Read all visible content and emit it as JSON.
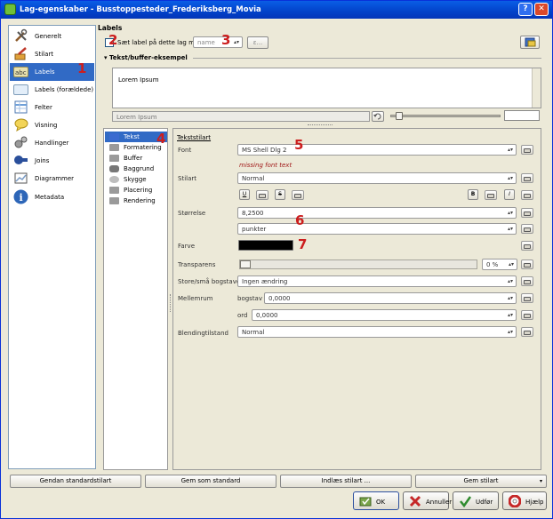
{
  "window": {
    "title": "Lag-egenskaber - Busstoppesteder_Frederiksberg_Movia",
    "help_btn": "?",
    "close_btn": "✕"
  },
  "sidebar": {
    "items": [
      {
        "label": "Generelt",
        "icon": "tools-icon",
        "color": "#8b5a2b"
      },
      {
        "label": "Stilart",
        "icon": "brush-icon",
        "color": "#c0392b"
      },
      {
        "label": "Labels",
        "icon": "abc-label-icon",
        "color": "#e8e1b0",
        "active": true
      },
      {
        "label": "Labels (forældede)",
        "icon": "labels-old-icon",
        "color": "#e3eef9"
      },
      {
        "label": "Felter",
        "icon": "table-icon",
        "color": "#6e9fd8"
      },
      {
        "label": "Visning",
        "icon": "speech-bubble-icon",
        "color": "#f2d458"
      },
      {
        "label": "Handlinger",
        "icon": "gears-icon",
        "color": "#808080"
      },
      {
        "label": "Joins",
        "icon": "joins-icon",
        "color": "#2a4f9b"
      },
      {
        "label": "Diagrammer",
        "icon": "diagram-icon",
        "color": "#7a9cc6"
      },
      {
        "label": "Metadata",
        "icon": "info-icon",
        "color": "#2d66b8"
      }
    ]
  },
  "labels": {
    "title": "Labels",
    "checkbox_label": "Sæt label på dette lag med",
    "field_combo": "name",
    "expression_btn": "ε...",
    "section_title": "Tekst/buffer-eksempel",
    "preview_text": "Lorem Ipsum",
    "preview_input": "Lorem Ipsum"
  },
  "tabs": [
    {
      "label": "Tekst",
      "icon": "text-tab-icon",
      "color": "#3a6ad0",
      "active": true
    },
    {
      "label": "Formatering",
      "icon": "formatting-tab-icon",
      "color": "#9a9a9a"
    },
    {
      "label": "Buffer",
      "icon": "buffer-tab-icon",
      "color": "#9a9a9a"
    },
    {
      "label": "Baggrund",
      "icon": "background-tab-icon",
      "color": "#777777"
    },
    {
      "label": "Skygge",
      "icon": "shadow-tab-icon",
      "color": "#bdbdbd"
    },
    {
      "label": "Placering",
      "icon": "placement-tab-icon",
      "color": "#9a9a9a"
    },
    {
      "label": "Rendering",
      "icon": "rendering-tab-icon",
      "color": "#9a9a9a"
    }
  ],
  "text_style": {
    "subtitle": "Tekststilart",
    "font_label": "Font",
    "font_value": "MS Shell Dlg 2",
    "missing_font": "missing font text",
    "style_label": "Stilart",
    "style_value": "Normal",
    "underline_btn": "U",
    "strike_btn": "S",
    "bold_btn": "B",
    "italic_btn": "I",
    "size_label": "Størrelse",
    "size_value": "8,2500",
    "unit_value": "punkter",
    "color_label": "Farve",
    "transparency_label": "Transparens",
    "transparency_value": "0 %",
    "case_label": "Store/små bogstaver",
    "case_value": "Ingen ændring",
    "spacing_label": "Mellemrum",
    "letter_label": "bogstav",
    "letter_value": "0,0000",
    "word_label": "ord",
    "word_value": "0,0000",
    "blend_label": "Blendingtilstand",
    "blend_value": "Normal",
    "text_color": "#000000"
  },
  "annotations": [
    "1",
    "2",
    "3",
    "4",
    "5",
    "6",
    "7"
  ],
  "bottom_buttons": {
    "restore": "Gendan standardstilart",
    "save_default": "Gem som standard",
    "load_style": "Indlæs stilart ...",
    "save_style": "Gem stilart"
  },
  "dialog_buttons": {
    "ok": "OK",
    "cancel": "Annuller",
    "apply": "Udfør",
    "help": "Hjælp"
  }
}
